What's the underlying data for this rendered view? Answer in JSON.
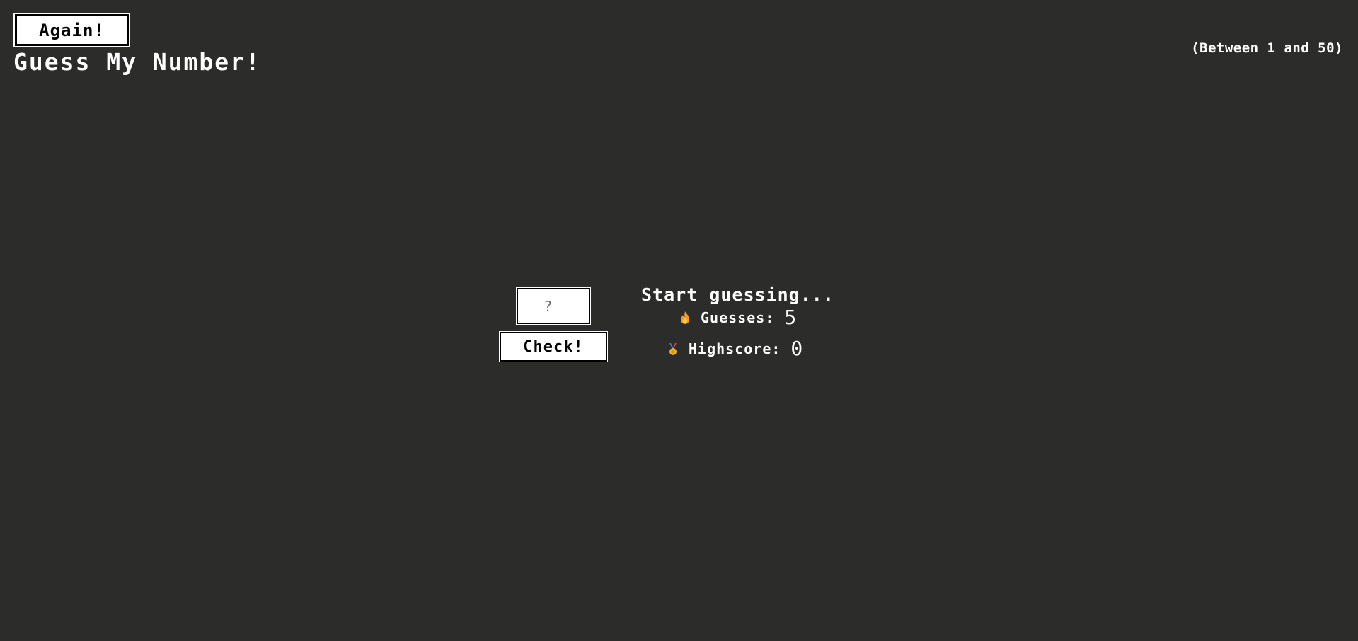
{
  "header": {
    "again_label": "Again!",
    "title": "Guess My Number!",
    "range_hint": "(Between 1 and 50)"
  },
  "game": {
    "input_placeholder": "?",
    "check_label": "Check!",
    "message": "Start guessing...",
    "guesses_label": "Guesses:",
    "guesses_value": "5",
    "highscore_label": "Highscore:",
    "highscore_value": "0"
  },
  "icons": {
    "guesses": "fire-icon",
    "highscore": "medal-icon"
  },
  "colors": {
    "background": "#2c2d2b",
    "text": "#ffffff",
    "button_bg": "#ffffff",
    "fire": "#f39a2b",
    "medal": "#f0b429"
  }
}
